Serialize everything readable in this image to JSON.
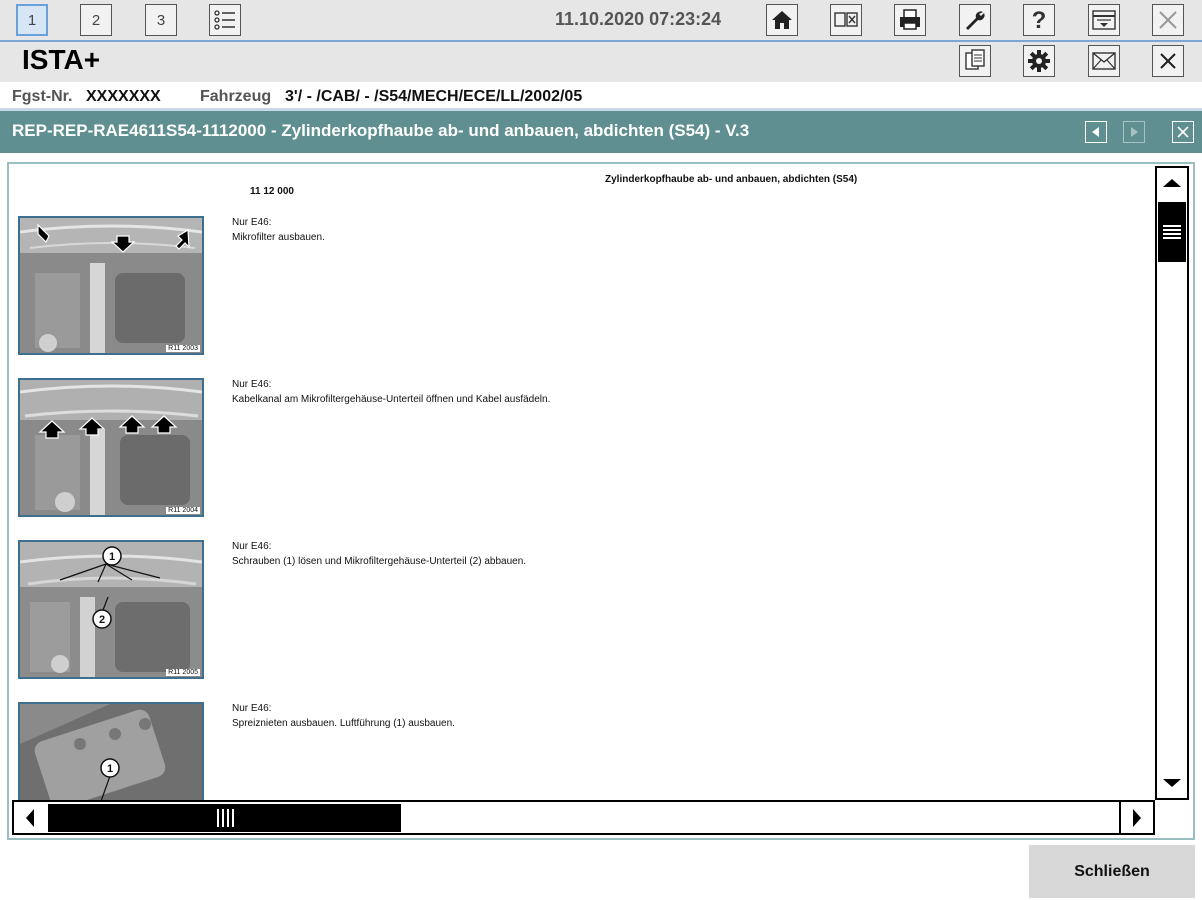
{
  "toolbar": {
    "tabs": [
      "1",
      "2",
      "3"
    ],
    "datetime": "11.10.2020 07:23:24"
  },
  "app": {
    "title": "ISTA+"
  },
  "vehicle": {
    "fgst_label": "Fgst-Nr.",
    "fgst_value": "XXXXXXX",
    "fahrzeug_label": "Fahrzeug",
    "fahrzeug_value": "3'/ - /CAB/ - /S54/MECH/ECE/LL/2002/05"
  },
  "document": {
    "title": "REP-REP-RAE4611S54-1112000 - Zylinderkopfhaube ab- und anbauen, abdichten (S54) - V.3",
    "heading": "Zylinderkopfhaube ab- und anbauen, abdichten (S54)",
    "code": "11 12 000",
    "steps": [
      {
        "line1": "Nur E46:",
        "line2": "Mikrofilter ausbauen.",
        "image_code": "R11 2003"
      },
      {
        "line1": "Nur E46:",
        "line2": "Kabelkanal am Mikrofiltergehäuse-Unterteil öffnen und Kabel ausfädeln.",
        "image_code": "R11 2004"
      },
      {
        "line1": "Nur E46:",
        "line2": "Schrauben (1) lösen und Mikrofiltergehäuse-Unterteil (2) abbauen.",
        "image_code": "R11 2005"
      },
      {
        "line1": "Nur E46:",
        "line2": "Spreiznieten ausbauen. Luftführung (1) ausbauen.",
        "image_code": ""
      }
    ]
  },
  "footer": {
    "close_label": "Schließen"
  }
}
